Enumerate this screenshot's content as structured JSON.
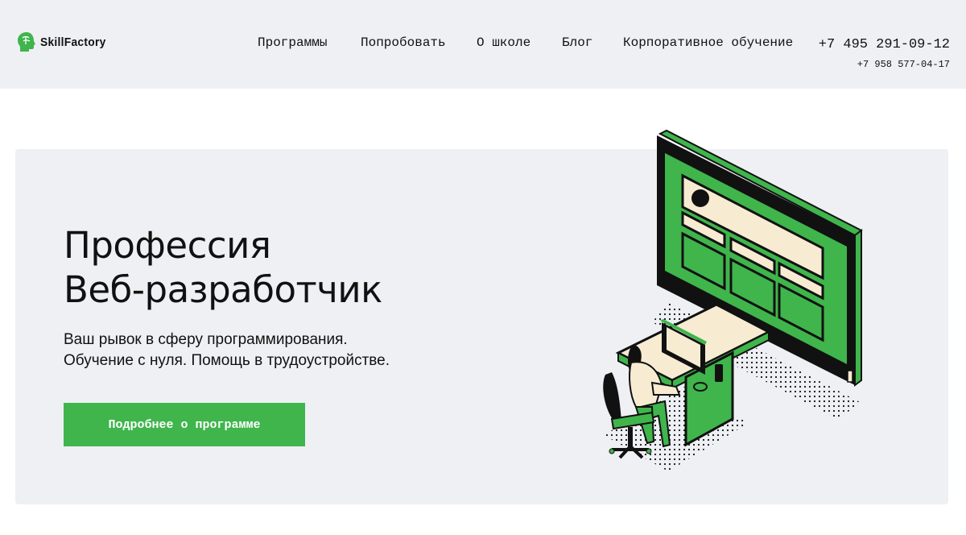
{
  "header": {
    "logo_text": "SkillFactory",
    "logo_icon": "brain-head-icon",
    "nav": [
      {
        "label": "Программы"
      },
      {
        "label": "Попробовать"
      },
      {
        "label": "О школе"
      },
      {
        "label": "Блог"
      },
      {
        "label": "Корпоративное обучение"
      }
    ],
    "phone_main": "+7 495 291-09-12",
    "phone_alt": "+7 958 577-04-17"
  },
  "hero": {
    "title_line1": "Профессия",
    "title_line2": "Веб-разработчик",
    "subtitle_line1": "Ваш рывок в сферу программирования.",
    "subtitle_line2": "Обучение с нуля. Помощь в трудоустройстве.",
    "cta_label": "Подробнее о программе",
    "illustration": "developer-at-monitor-illustration"
  },
  "colors": {
    "brand_green": "#3fb54c",
    "panel_bg": "#eef0f4",
    "cream": "#f7ecd2"
  }
}
